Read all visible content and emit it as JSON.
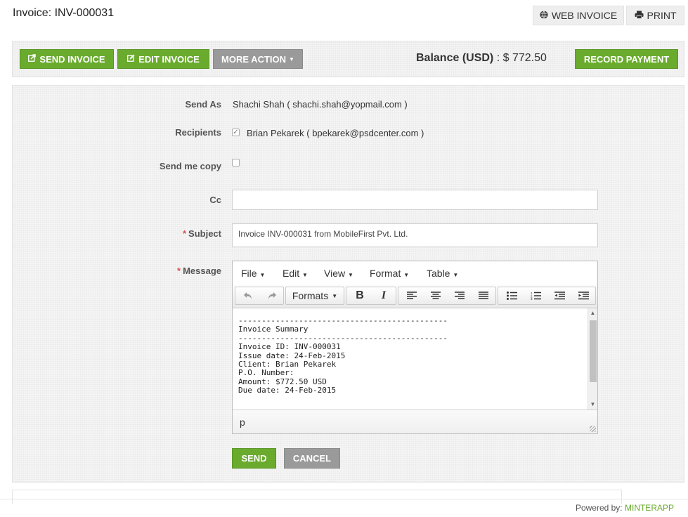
{
  "header": {
    "title": "Invoice: INV-000031",
    "web_invoice_label": "WEB INVOICE",
    "print_label": "PRINT"
  },
  "actions": {
    "send_invoice_label": "SEND INVOICE",
    "edit_invoice_label": "EDIT INVOICE",
    "more_action_label": "MORE ACTION",
    "balance_label": "Balance (USD)",
    "balance_value": ": $ 772.50",
    "record_payment_label": "RECORD PAYMENT"
  },
  "form": {
    "send_as_label": "Send As",
    "send_as_value": "Shachi Shah ( shachi.shah@yopmail.com )",
    "recipients_label": "Recipients",
    "recipient_value": "Brian Pekarek ( bpekarek@psdcenter.com )",
    "send_me_copy_label": "Send me copy",
    "cc_label": "Cc",
    "cc_value": "",
    "subject_label": "Subject",
    "subject_value": "Invoice INV-000031 from MobileFirst Pvt. Ltd.",
    "message_label": "Message",
    "required_mark": "*"
  },
  "editor": {
    "menu": [
      "File",
      "Edit",
      "View",
      "Format",
      "Table"
    ],
    "formats_label": "Formats",
    "bold_label": "B",
    "italic_label": "I",
    "content": "---------------------------------------------\nInvoice Summary\n---------------------------------------------\nInvoice ID: INV-000031\nIssue date: 24-Feb-2015\nClient: Brian Pekarek\nP.O. Number:\nAmount: $772.50 USD\nDue date: 24-Feb-2015",
    "status_path": "p"
  },
  "buttons": {
    "send_label": "SEND",
    "cancel_label": "CANCEL"
  },
  "footer": {
    "powered_by": "Powered by:",
    "brand": "MINTERAPP"
  },
  "colors": {
    "accent_green": "#6aab2e",
    "gray_button": "#9a9a9a",
    "required": "#d9534f"
  }
}
